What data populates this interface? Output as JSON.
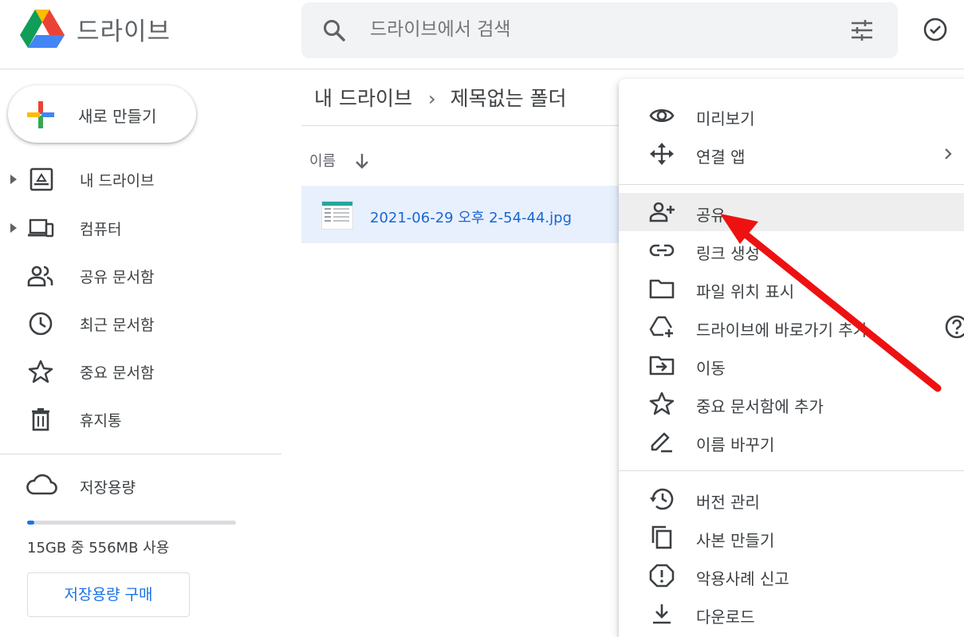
{
  "header": {
    "app_name": "드라이브",
    "search_placeholder": "드라이브에서 검색",
    "icons": [
      "drive-logo",
      "search-icon",
      "tune-icon",
      "offline-status-icon"
    ]
  },
  "sidebar": {
    "new_button": "새로 만들기",
    "items": [
      {
        "label": "내 드라이브",
        "icon": "my-drive-icon",
        "expandable": true
      },
      {
        "label": "컴퓨터",
        "icon": "computers-icon",
        "expandable": true
      },
      {
        "label": "공유 문서함",
        "icon": "shared-icon",
        "expandable": false
      },
      {
        "label": "최근 문서함",
        "icon": "clock-icon",
        "expandable": false
      },
      {
        "label": "중요 문서함",
        "icon": "star-icon",
        "expandable": false
      },
      {
        "label": "휴지통",
        "icon": "trash-icon",
        "expandable": false
      }
    ],
    "storage": {
      "label": "저장용량",
      "usage_text": "15GB 중 556MB 사용",
      "used_fraction": 0.036,
      "buy_button": "저장용량 구매"
    }
  },
  "main": {
    "breadcrumb": [
      "내 드라이브",
      "제목없는 폴더"
    ],
    "sort_column": "이름",
    "files": [
      {
        "name": "2021-06-29 오후 2-54-44.jpg",
        "selected": true
      }
    ]
  },
  "context_menu": {
    "groups": [
      [
        {
          "label": "미리보기",
          "icon": "eye-icon"
        },
        {
          "label": "연결 앱",
          "icon": "open-with-icon",
          "submenu": true
        }
      ],
      [
        {
          "label": "공유",
          "icon": "person-add-icon",
          "highlighted": true
        },
        {
          "label": "링크 생성",
          "icon": "link-icon"
        },
        {
          "label": "파일 위치 표시",
          "icon": "folder-icon"
        },
        {
          "label": "드라이브에 바로가기 추가",
          "icon": "add-shortcut-icon",
          "help": true
        },
        {
          "label": "이동",
          "icon": "move-icon"
        },
        {
          "label": "중요 문서함에 추가",
          "icon": "star-icon"
        },
        {
          "label": "이름 바꾸기",
          "icon": "rename-icon"
        }
      ],
      [
        {
          "label": "버전 관리",
          "icon": "history-icon"
        },
        {
          "label": "사본 만들기",
          "icon": "copy-icon"
        },
        {
          "label": "악용사례 신고",
          "icon": "report-icon"
        },
        {
          "label": "다운로드",
          "icon": "download-icon"
        }
      ]
    ]
  },
  "colors": {
    "accent_blue": "#1a73e8",
    "selection_bg": "#e8f0fe",
    "annotation_arrow": "#ee1111",
    "menu_highlight": "#eeeeee"
  }
}
